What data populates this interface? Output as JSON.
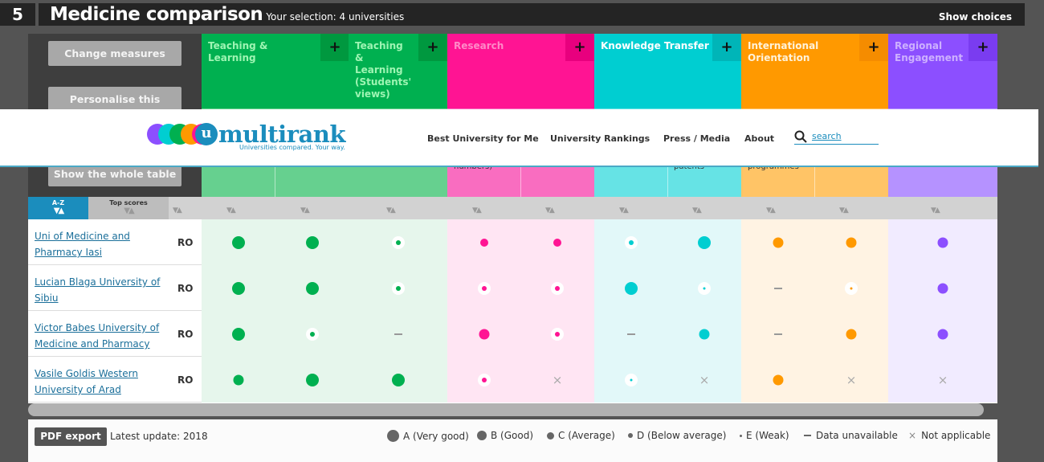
{
  "header": {
    "step": "5",
    "title": "Medicine comparison",
    "selection": "Your selection: 4 universities",
    "show_choices": "Show choices"
  },
  "left_buttons": [
    "Change measures",
    "Personalise this ranking",
    "Show the whole table"
  ],
  "dimensions": [
    {
      "label": "Teaching & Learning",
      "color": "#00b050"
    },
    {
      "label": "Teaching & Learning (Students' views)",
      "color": "#00b050"
    },
    {
      "label": "Research",
      "color": "#ff1493"
    },
    {
      "label": "Knowledge Transfer",
      "color": "#00ced1"
    },
    {
      "label": "International Orientation",
      "color": "#ff9900"
    },
    {
      "label": "Regional Engagement",
      "color": "#8c4fff"
    }
  ],
  "subheader_fragments": {
    "research": "numbers)",
    "knowledge": "patents",
    "international": "programmes"
  },
  "nav": {
    "logo_text": "multirank",
    "logo_tagline": "Universities compared. Your way.",
    "items": [
      "Best University for Me",
      "University Rankings",
      "Press / Media",
      "About"
    ],
    "search_label": "search"
  },
  "sort": {
    "az": "A-Z",
    "top": "Top scores"
  },
  "rows": [
    {
      "name": "Uni of Medicine and Pharmacy Iasi",
      "country": "RO",
      "grades": [
        "A",
        "A",
        "D",
        "C",
        "C",
        "D",
        "A",
        "B",
        "B",
        "B"
      ]
    },
    {
      "name": "Lucian Blaga University of Sibiu",
      "country": "RO",
      "grades": [
        "A",
        "A",
        "D",
        "D",
        "D",
        "A",
        "E",
        "-",
        "E",
        "B"
      ]
    },
    {
      "name": "Victor Babes University of Medicine and Pharmacy",
      "country": "RO",
      "grades": [
        "A",
        "D",
        "-",
        "B",
        "D",
        "-",
        "B",
        "-",
        "B",
        "B"
      ]
    },
    {
      "name": "Vasile Goldis Western University of Arad",
      "country": "RO",
      "grades": [
        "B",
        "A",
        "A",
        "D",
        "x",
        "E",
        "x",
        "B",
        "x",
        "x"
      ]
    }
  ],
  "footer": {
    "pdf": "PDF export",
    "latest": "Latest update:  2018",
    "legend": [
      "A (Very good)",
      "B (Good)",
      "C (Average)",
      "D (Below average)",
      "E (Weak)",
      "Data unavailable",
      "Not applicable"
    ]
  }
}
